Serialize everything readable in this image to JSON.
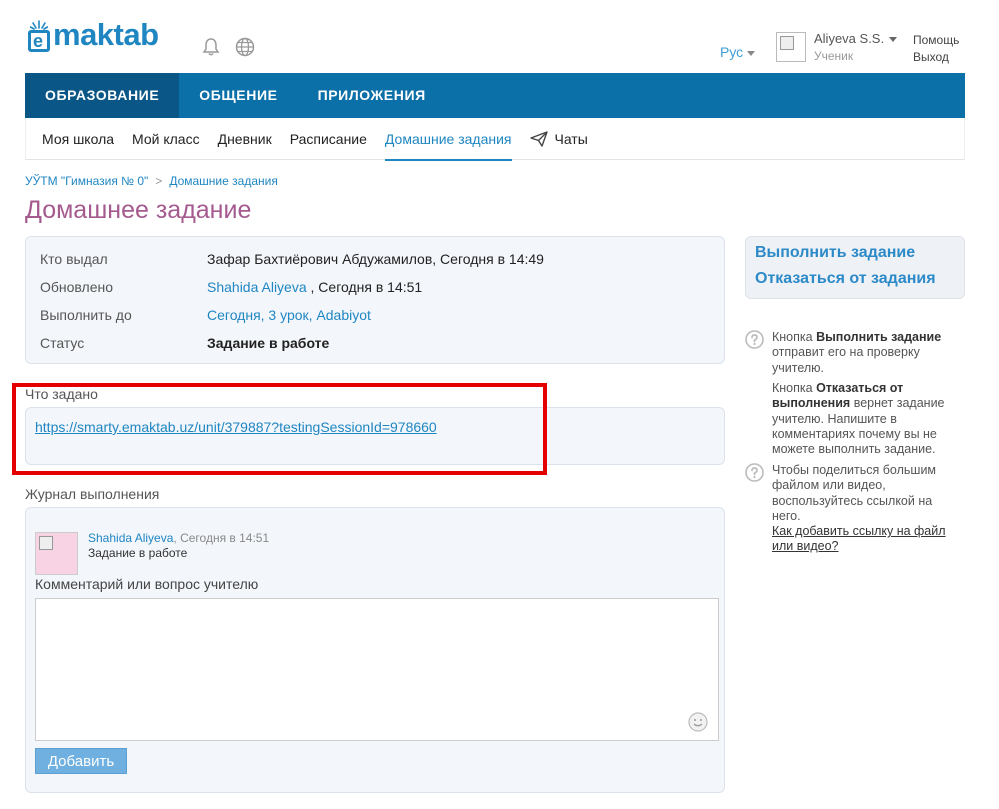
{
  "header": {
    "logo_text": "maktab",
    "logo_letter": "e",
    "language": "Рус",
    "user_name": "Aliyeva S.S.",
    "user_role": "Ученик",
    "help": "Помощь",
    "logout": "Выход"
  },
  "main_nav": [
    {
      "label": "ОБРАЗОВАНИЕ"
    },
    {
      "label": "ОБЩЕНИЕ"
    },
    {
      "label": "ПРИЛОЖЕНИЯ"
    }
  ],
  "sub_nav": [
    {
      "label": "Моя школа"
    },
    {
      "label": "Мой класс"
    },
    {
      "label": "Дневник"
    },
    {
      "label": "Расписание"
    },
    {
      "label": "Домашние задания"
    },
    {
      "label": "Чаты"
    }
  ],
  "breadcrumb": {
    "school": "УЎТМ \"Гимназия № 0\"",
    "separator": ">",
    "current": "Домашние задания"
  },
  "page_title": "Домашнее задание",
  "info": {
    "issued_by_label": "Кто выдал",
    "issued_by_value": "Зафар Бахтиёрович Абдужамилов, Сегодня в 14:49",
    "updated_label": "Обновлено",
    "updated_user": "Shahida Aliyeva",
    "updated_time": " , Сегодня в 14:51",
    "due_label": "Выполнить до",
    "due_value": "Сегодня, 3 урок, Adabiyot",
    "status_label": "Статус",
    "status_value": "Задание в работе"
  },
  "task": {
    "label": "Что задано",
    "link": "https://smarty.emaktab.uz/unit/379887?testingSessionId=978660"
  },
  "journal": {
    "label": "Журнал выполнения",
    "author": "Shahida Aliyeva",
    "time": ", Сегодня в 14:51",
    "status": "Задание в работе",
    "comment_label": "Комментарий или вопрос учителю",
    "comment_value": "",
    "add_button": "Добавить"
  },
  "actions": {
    "complete": "Выполнить задание",
    "decline": "Отказаться от задания"
  },
  "help": {
    "h1_pre": "Кнопка ",
    "h1_bold": "Выполнить задание",
    "h1_post": " отправит его на проверку учителю.",
    "h2_pre": "Кнопка ",
    "h2_bold": "Отказаться от выполнения",
    "h2_post": " вернет задание учителю. Напишите в комментариях почему вы не можете выполнить задание.",
    "h3_text": "Чтобы поделиться большим файлом или видео, воспользуйтесь ссылкой на него.",
    "h3_link": "Как добавить ссылку на файл или видео?"
  },
  "colors": {
    "nav_blue": "#0b6fa8",
    "nav_active": "#0a5787",
    "title_purple": "#a45a8e",
    "link_blue": "#1f86c2",
    "highlight_red": "#e40000"
  }
}
